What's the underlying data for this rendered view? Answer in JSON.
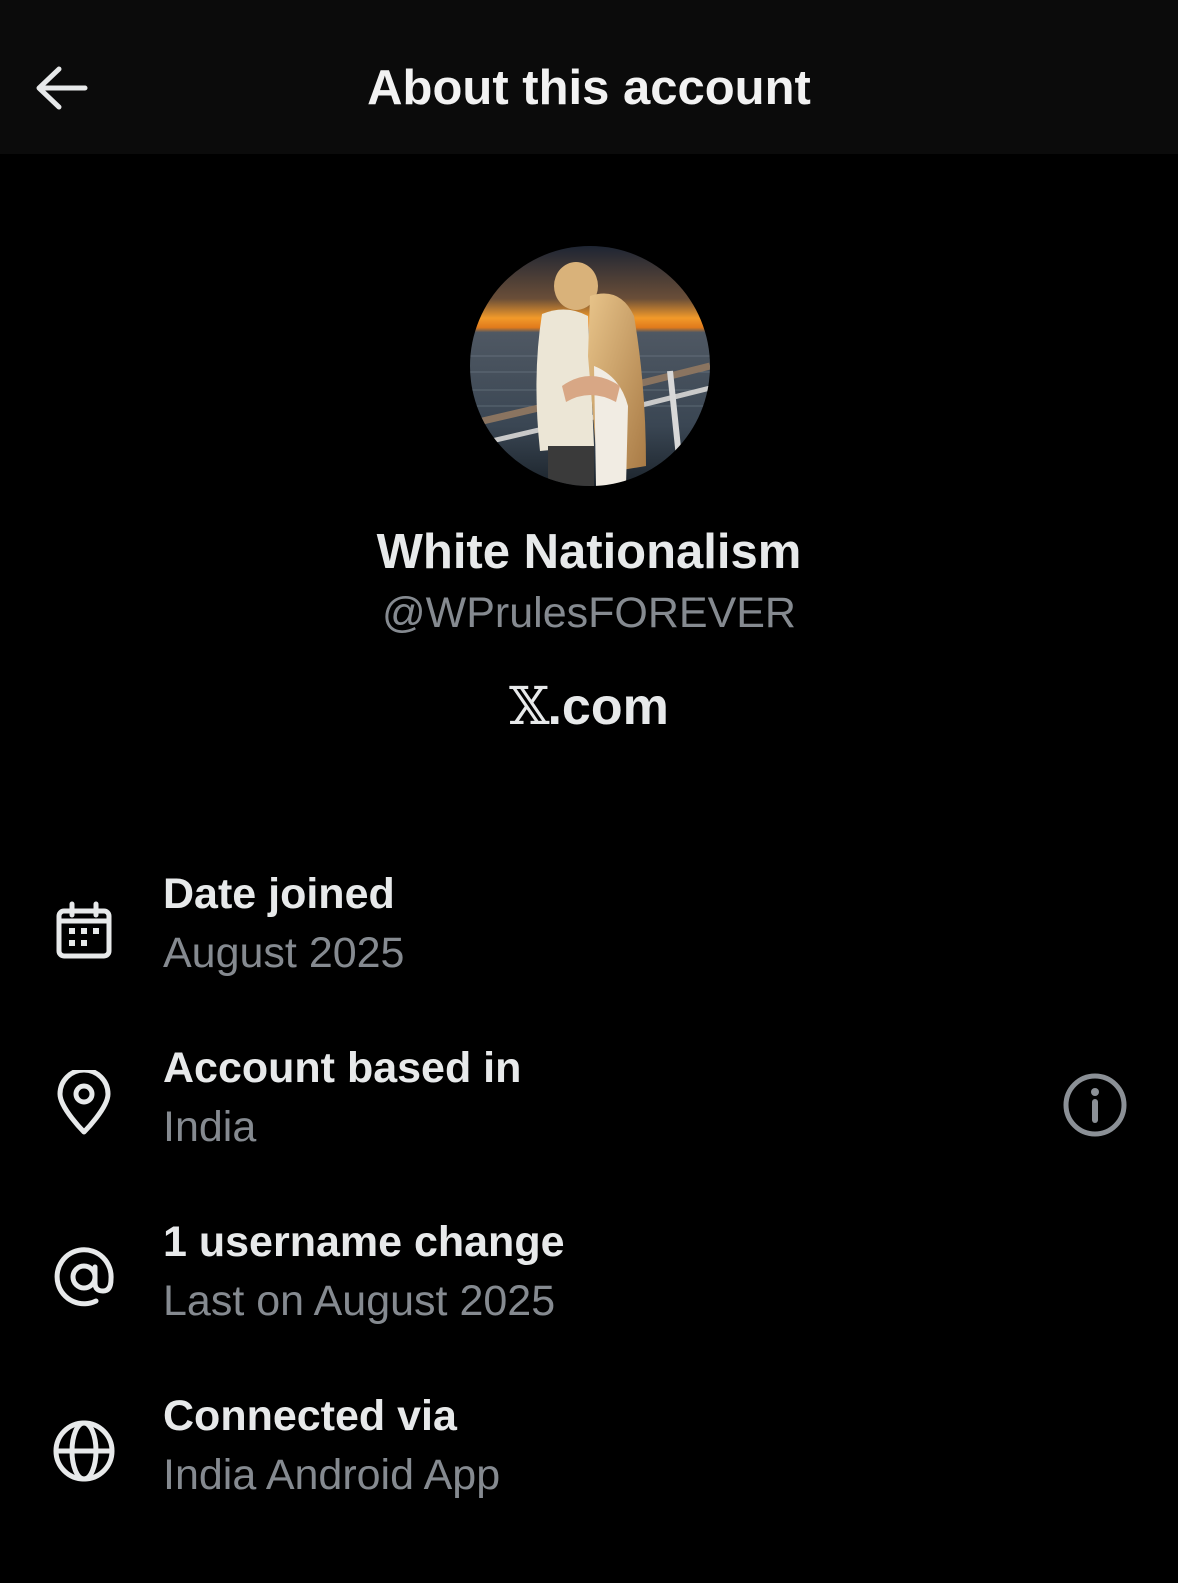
{
  "header": {
    "title": "About this account",
    "back_icon": "arrow-left-icon"
  },
  "profile": {
    "display_name": "White Nationalism",
    "handle": "@WPrulesFOREVER",
    "platform_x": "𝕏",
    "platform_suffix": ".com"
  },
  "details": [
    {
      "icon": "calendar-icon",
      "label": "Date joined",
      "value": "August 2025"
    },
    {
      "icon": "location-pin-icon",
      "label": "Account based in",
      "value": "India",
      "action_icon": "info-icon"
    },
    {
      "icon": "at-sign-icon",
      "label": "1 username change",
      "value": "Last on August 2025"
    },
    {
      "icon": "globe-icon",
      "label": "Connected via",
      "value": "India Android App"
    }
  ],
  "colors": {
    "background": "#000000",
    "header_background": "#0b0b0b",
    "primary_text": "#e7e9ea",
    "secondary_text": "#858a90",
    "icon": "#e7e9ea",
    "info_icon": "#8b9096"
  }
}
